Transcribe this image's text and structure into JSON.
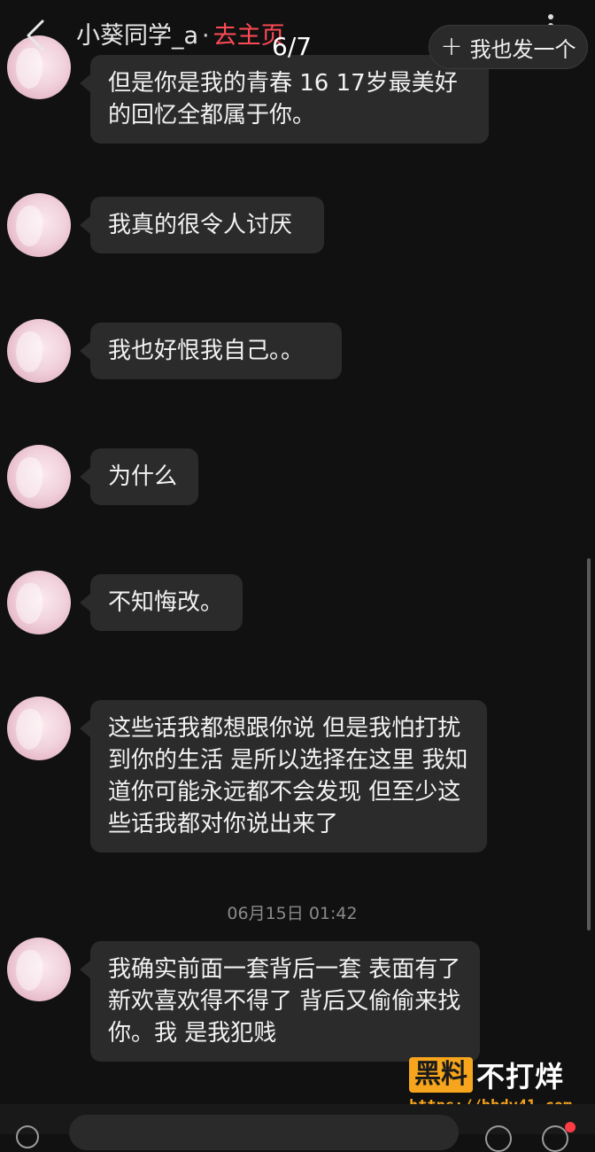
{
  "header": {
    "username": "小葵同学_a",
    "separator": "·",
    "home_link": "去主页",
    "page_counter": "6/7",
    "post_button_label": "我也发一个",
    "post_button_icon": "plus-icon",
    "back_icon": "chevron-left-icon",
    "more_icon": "more-vertical-icon"
  },
  "messages": [
    {
      "text": "但是你是我的青春 16 17岁最美好的回忆全都属于你。"
    },
    {
      "text": "我真的很令人讨厌"
    },
    {
      "text": "我也好恨我自己。。"
    },
    {
      "text": "为什么"
    },
    {
      "text": "不知悔改。"
    },
    {
      "text": "这些话我都想跟你说 但是我怕打扰到你的生活 是所以选择在这里 我知道你可能永远都不会发现 但至少这些话我都对你说出来了"
    },
    {
      "text": "我确实前面一套背后一套 表面有了新欢喜欢得不得了 背后又偷偷来找你。我 是我犯贱"
    }
  ],
  "timestamp": "06月15日 01:42",
  "watermark": {
    "badge": "黑料",
    "text": "不打烊",
    "url": "https://bbdy41.com"
  },
  "colors": {
    "background": "#111111",
    "bubble": "#2b2b2b",
    "accent_red": "#ff4a55",
    "watermark_orange": "#f7a51c"
  }
}
